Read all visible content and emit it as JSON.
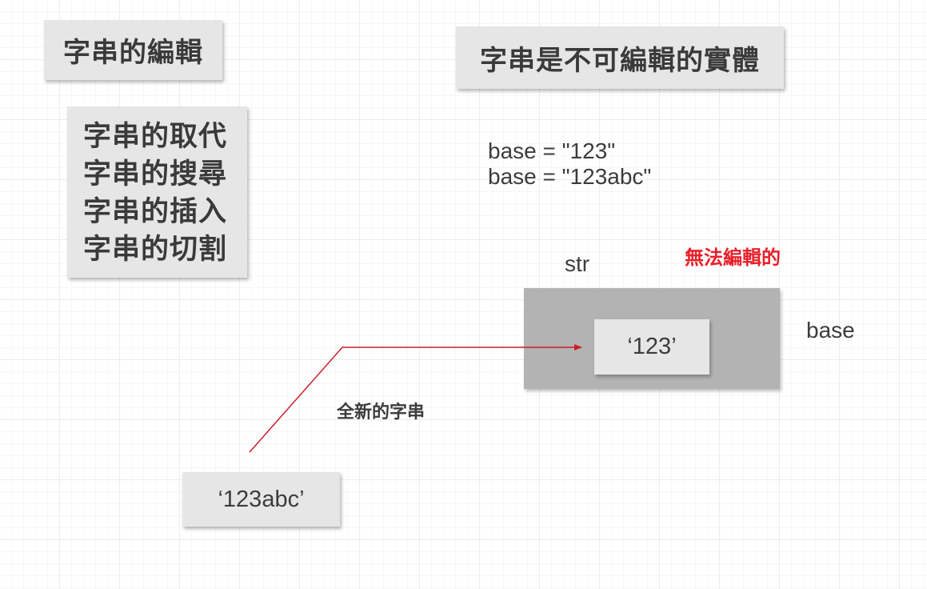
{
  "title_left": "字串的編輯",
  "title_right": "字串是不可編輯的實體",
  "operations": [
    "字串的取代",
    "字串的搜尋",
    "字串的插入",
    "字串的切割"
  ],
  "code_lines": [
    "base = \"123\"",
    "base = \"123abc\""
  ],
  "labels": {
    "str": "str",
    "not_editable": "無法編輯的",
    "base": "base",
    "new_string": "全新的字串"
  },
  "values": {
    "old": "‘123’",
    "new": "‘123abc’"
  },
  "colors": {
    "arrow": "#c8202a",
    "not_editable": "#e8202a",
    "card": "#e6e6e6",
    "container": "#b3b3b3"
  }
}
